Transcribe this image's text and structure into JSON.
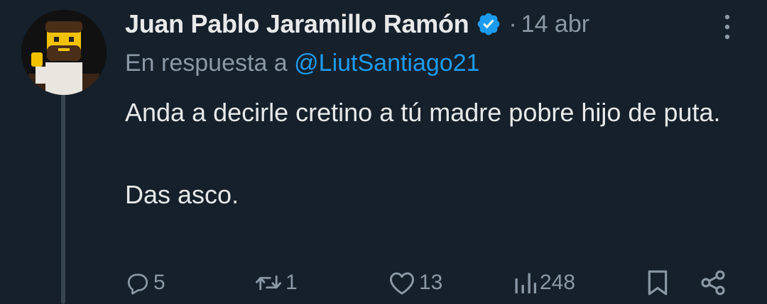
{
  "tweet": {
    "display_name": "Juan Pablo Jaramillo Ramón",
    "verified": true,
    "separator": "·",
    "time": "14 abr",
    "reply_prefix": "En respuesta a ",
    "reply_handle": "@LiutSantiago21",
    "text_line1": "Anda a decirle cretino a tú madre pobre hijo de puta.",
    "text_line2": "Das asco."
  },
  "actions": {
    "replies": "5",
    "retweets": "1",
    "likes": "13",
    "views": "248"
  },
  "icons": {
    "verified": "verified-badge-icon",
    "more": "more-vertical-icon",
    "reply": "reply-icon",
    "retweet": "retweet-icon",
    "like": "heart-icon",
    "views": "views-icon",
    "bookmark": "bookmark-icon",
    "share": "share-icon"
  },
  "colors": {
    "background": "#15202b",
    "text": "#e7e9ea",
    "muted": "#8b98a5",
    "accent": "#1d9bf0",
    "thread_line": "#38444d"
  }
}
